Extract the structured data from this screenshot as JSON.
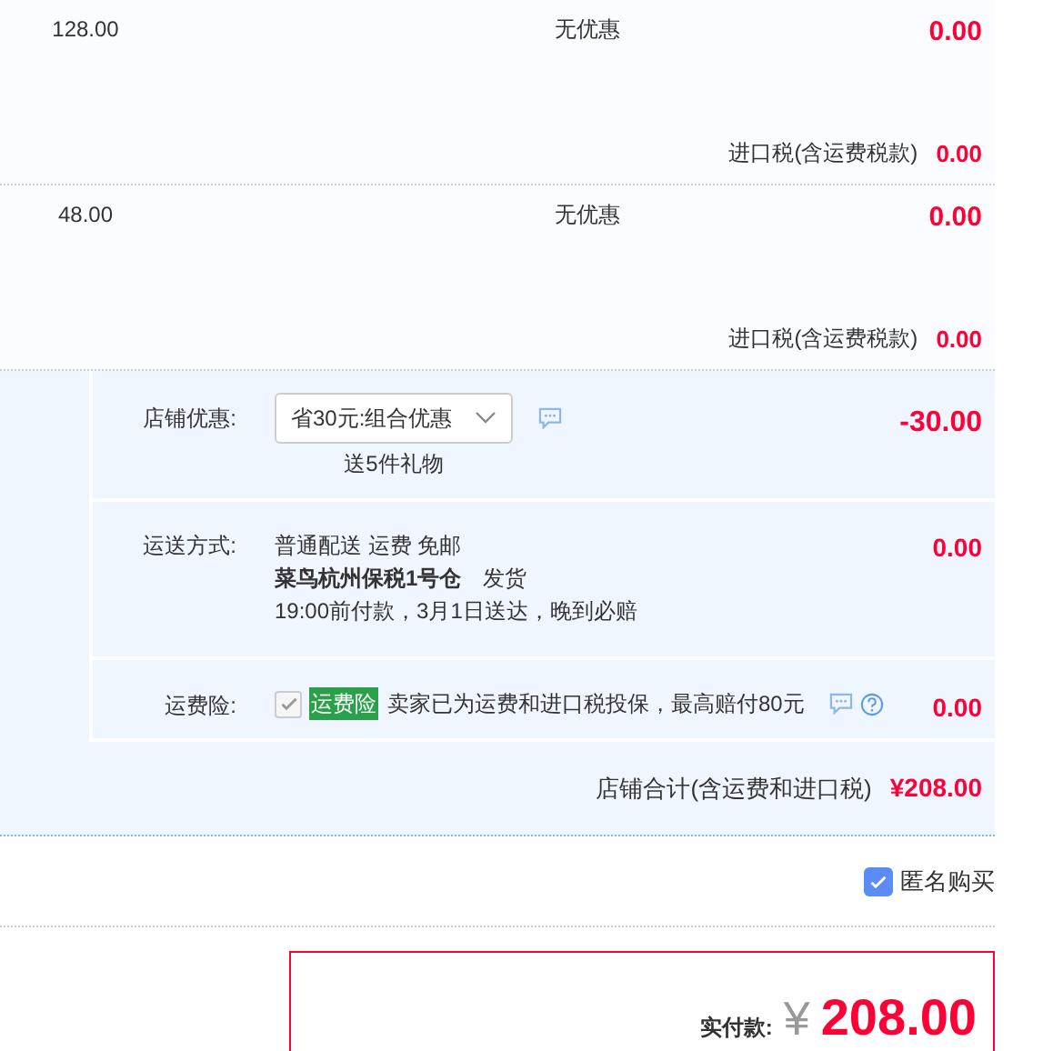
{
  "items": [
    {
      "price": "128.00",
      "discount": "无优惠",
      "amount": "0.00",
      "tax_label": "进口税(含运费税款)",
      "tax_amount": "0.00"
    },
    {
      "price": "48.00",
      "discount": "无优惠",
      "amount": "0.00",
      "tax_label": "进口税(含运费税款)",
      "tax_amount": "0.00"
    }
  ],
  "shop": {
    "discount": {
      "label": "店铺优惠:",
      "select_value": "省30元:组合优惠",
      "gift": "送5件礼物",
      "amount": "-30.00"
    },
    "shipping": {
      "label": "运送方式:",
      "lines": [
        "普通配送 运费 免邮",
        "**菜鸟杭州保税1号仓**　发货",
        "19:00前付款，3月1日送达，晚到必赔"
      ],
      "amount": "0.00"
    },
    "insurance": {
      "label": "运费险:",
      "checked": true,
      "disabled": true,
      "tag": "运费险",
      "text": "卖家已为运费和进口税投保，最高赔付80元",
      "amount": "0.00"
    },
    "total": {
      "label": "店铺合计(含运费和进口税)",
      "amount": "¥208.00"
    }
  },
  "anonymous": {
    "label": "匿名购买",
    "checked": true
  },
  "payment": {
    "label": "实付款:",
    "currency": "¥",
    "amount": "208.00"
  }
}
